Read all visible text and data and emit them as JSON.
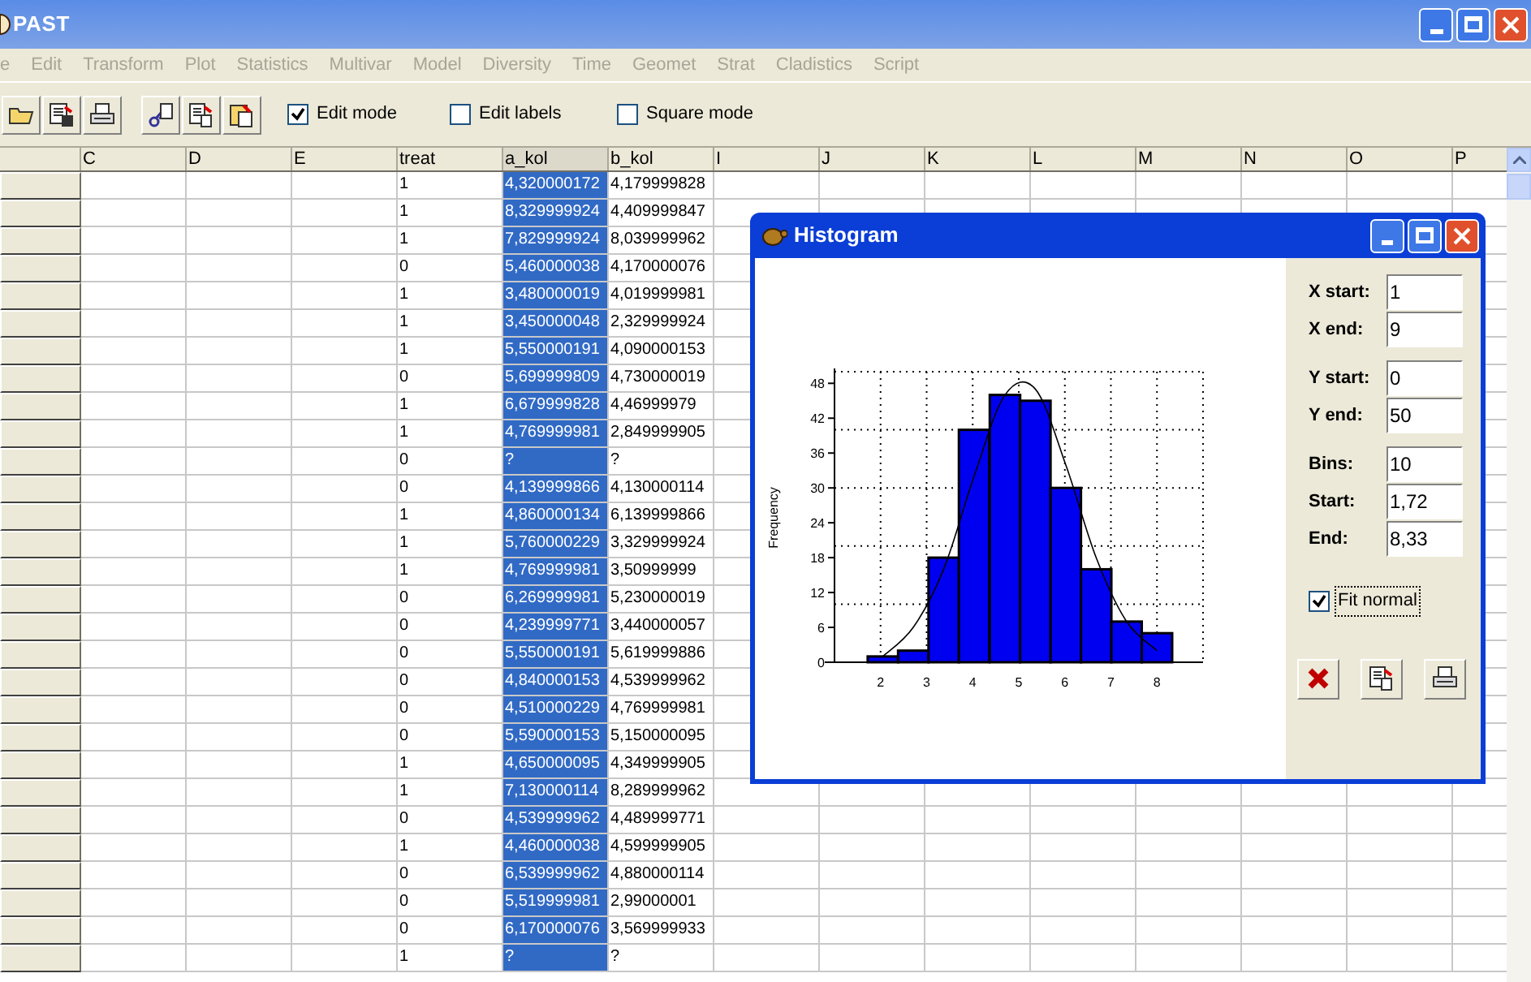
{
  "window": {
    "title": "PAST"
  },
  "menu": [
    "e",
    "Edit",
    "Transform",
    "Plot",
    "Statistics",
    "Multivar",
    "Model",
    "Diversity",
    "Time",
    "Geomet",
    "Strat",
    "Cladistics",
    "Script"
  ],
  "toolbar": {
    "checkboxes": [
      {
        "label": "Edit mode",
        "checked": true
      },
      {
        "label": "Edit labels",
        "checked": false
      },
      {
        "label": "Square mode",
        "checked": false
      }
    ]
  },
  "sheet": {
    "columns": [
      {
        "label": "C",
        "selected": false
      },
      {
        "label": "D",
        "selected": false
      },
      {
        "label": "E",
        "selected": false
      },
      {
        "label": "treat",
        "selected": false
      },
      {
        "label": "a_kol",
        "selected": true
      },
      {
        "label": "b_kol",
        "selected": false
      },
      {
        "label": "I",
        "selected": false
      },
      {
        "label": "J",
        "selected": false
      },
      {
        "label": "K",
        "selected": false
      },
      {
        "label": "L",
        "selected": false
      },
      {
        "label": "M",
        "selected": false
      },
      {
        "label": "N",
        "selected": false
      },
      {
        "label": "O",
        "selected": false
      },
      {
        "label": "P",
        "selected": false
      }
    ],
    "rows": [
      [
        "1",
        "4,320000172",
        "4,179999828"
      ],
      [
        "1",
        "8,329999924",
        "4,409999847"
      ],
      [
        "1",
        "7,829999924",
        "8,039999962"
      ],
      [
        "0",
        "5,460000038",
        "4,170000076"
      ],
      [
        "1",
        "3,480000019",
        "4,019999981"
      ],
      [
        "1",
        "3,450000048",
        "2,329999924"
      ],
      [
        "1",
        "5,550000191",
        "4,090000153"
      ],
      [
        "0",
        "5,699999809",
        "4,730000019"
      ],
      [
        "1",
        "6,679999828",
        "4,46999979"
      ],
      [
        "1",
        "4,769999981",
        "2,849999905"
      ],
      [
        "0",
        "?",
        "?"
      ],
      [
        "0",
        "4,139999866",
        "4,130000114"
      ],
      [
        "1",
        "4,860000134",
        "6,139999866"
      ],
      [
        "1",
        "5,760000229",
        "3,329999924"
      ],
      [
        "1",
        "4,769999981",
        "3,50999999"
      ],
      [
        "0",
        "6,269999981",
        "5,230000019"
      ],
      [
        "0",
        "4,239999771",
        "3,440000057"
      ],
      [
        "0",
        "5,550000191",
        "5,619999886"
      ],
      [
        "0",
        "4,840000153",
        "4,539999962"
      ],
      [
        "0",
        "4,510000229",
        "4,769999981"
      ],
      [
        "0",
        "5,590000153",
        "5,150000095"
      ],
      [
        "1",
        "4,650000095",
        "4,349999905"
      ],
      [
        "1",
        "7,130000114",
        "8,289999962"
      ],
      [
        "0",
        "4,539999962",
        "4,489999771"
      ],
      [
        "1",
        "4,460000038",
        "4,599999905"
      ],
      [
        "0",
        "6,539999962",
        "4,880000114"
      ],
      [
        "0",
        "5,519999981",
        "2,99000001"
      ],
      [
        "0",
        "6,170000076",
        "3,569999933"
      ],
      [
        "1",
        "?",
        "?"
      ]
    ]
  },
  "dialog": {
    "title": "Histogram",
    "chart_data": {
      "type": "bar",
      "ylabel": "Frequency",
      "x": [
        2.05,
        2.71,
        3.37,
        4.03,
        4.7,
        5.36,
        6.02,
        6.68,
        7.34,
        8.0
      ],
      "series": [
        {
          "color": "#0000f0",
          "values": [
            1,
            2,
            18,
            40,
            46,
            45,
            30,
            16,
            7,
            5
          ]
        },
        {
          "color": "#000000",
          "type": "line",
          "values": [
            1,
            6,
            16,
            32,
            46,
            47,
            34,
            18,
            7,
            2
          ]
        }
      ],
      "xlim": [
        1,
        9
      ],
      "ylim": [
        0,
        50
      ],
      "xticks": [
        2,
        3,
        4,
        5,
        6,
        7,
        8
      ],
      "yticks": [
        0,
        6,
        12,
        18,
        24,
        30,
        36,
        42,
        48
      ],
      "grid": true
    },
    "field_groups": [
      [
        {
          "label": "X start:",
          "value": "1"
        },
        {
          "label": "X end:",
          "value": "9"
        }
      ],
      [
        {
          "label": "Y start:",
          "value": "0"
        },
        {
          "label": "Y end:",
          "value": "50"
        }
      ],
      [
        {
          "label": "Bins:",
          "value": "10"
        },
        {
          "label": "Start:",
          "value": "1,72"
        },
        {
          "label": "End:",
          "value": "8,33"
        }
      ]
    ],
    "fit_normal": {
      "label": "Fit normal",
      "checked": true
    }
  }
}
